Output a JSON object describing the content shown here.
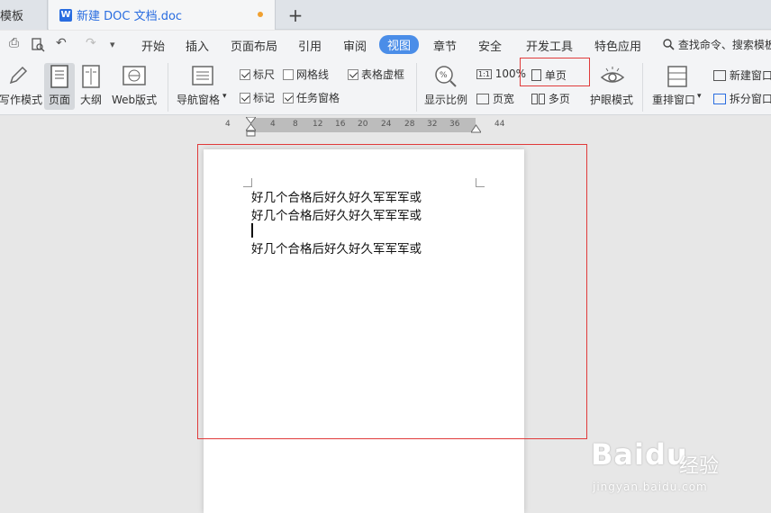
{
  "tabs": {
    "template_label": "模板",
    "doc_title": "新建 DOC 文档.doc",
    "doc_logo": "W",
    "add": "+"
  },
  "quick_access": {
    "print": "⎙",
    "preview": "🔍",
    "undo": "↶",
    "redo": "↷",
    "more": "▾"
  },
  "menu": [
    "开始",
    "插入",
    "页面布局",
    "引用",
    "审阅",
    "视图",
    "章节",
    "安全",
    "开发工具",
    "特色应用"
  ],
  "menu_active": "视图",
  "search": {
    "icon": "search-icon",
    "label": "查找命令、搜索模板"
  },
  "toolbar": {
    "write_mode": "写作模式",
    "page_view": "页面",
    "outline": "大纲",
    "web_layout": "Web版式",
    "nav_pane": "导航窗格",
    "ruler": {
      "label": "标尺",
      "checked": true
    },
    "gridlines": {
      "label": "网格线",
      "checked": false
    },
    "table_dashed": {
      "label": "表格虚框",
      "checked": true
    },
    "marks": {
      "label": "标记",
      "checked": true
    },
    "task_pane": {
      "label": "任务窗格",
      "checked": true
    },
    "zoom": "显示比例",
    "zoom_100": "100%",
    "page_width": "页宽",
    "single_page": "单页",
    "multi_page": "多页",
    "eye_mode": "护眼模式",
    "rearrange": "重排窗口",
    "new_window": "新建窗口",
    "split_window": "拆分窗口"
  },
  "ruler_ticks": [
    "4",
    "4",
    "8",
    "12",
    "16",
    "20",
    "24",
    "28",
    "32",
    "36",
    "44"
  ],
  "document": {
    "lines": [
      "好几个合格后好久好久军军军或",
      "好几个合格后好久好久军军军或",
      "好几个合格后好久好久军军军或"
    ]
  },
  "watermark": {
    "logo": "Baidu",
    "cn": "经验",
    "url": "jingyan.baidu.com"
  },
  "colors": {
    "accent": "#4a8de8",
    "highlight": "#e03a3a"
  }
}
